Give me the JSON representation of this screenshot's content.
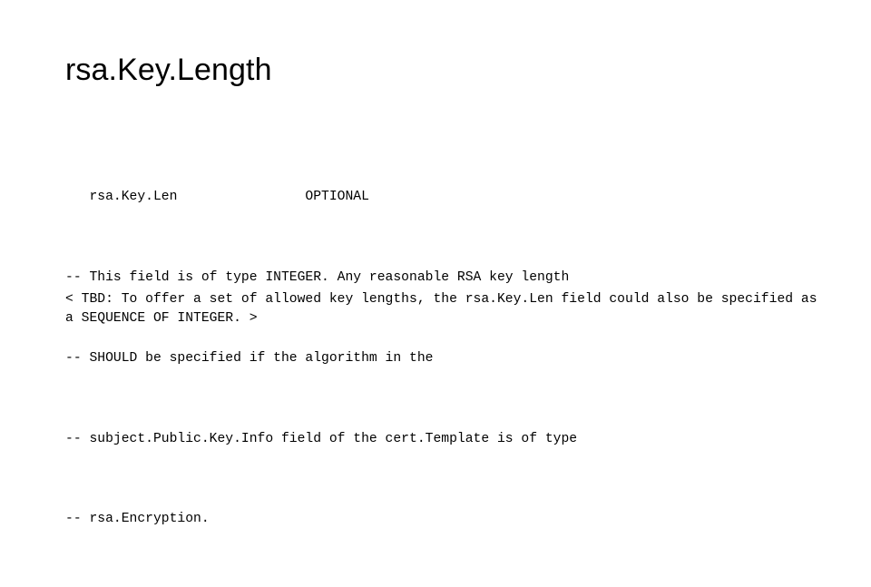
{
  "slide": {
    "title": "rsa.Key.Length",
    "code_lines": [
      "   rsa.Key.Len                OPTIONAL",
      "-- This field is of type INTEGER. Any reasonable RSA key length",
      "-- SHOULD be specified if the algorithm in the",
      "-- subject.Public.Key.Info field of the cert.Template is of type",
      "-- rsa.Encryption."
    ],
    "paragraph": "< TBD: To offer a set of allowed key lengths, the rsa.Key.Len field could also be specified as a SEQUENCE OF INTEGER. >"
  }
}
